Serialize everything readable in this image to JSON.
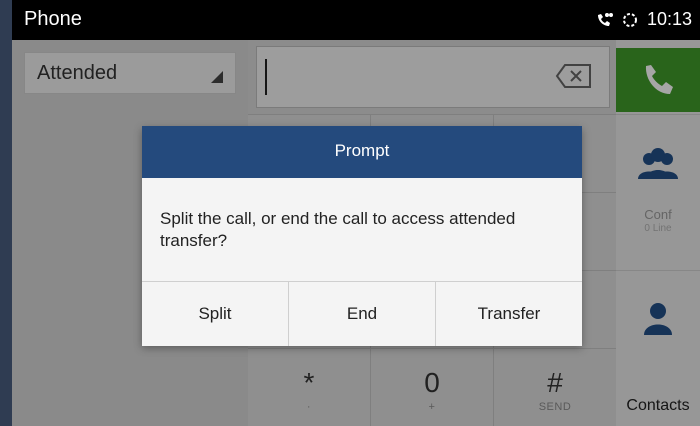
{
  "statusbar": {
    "title": "Phone",
    "time": "10:13",
    "icons": [
      "voicemail-icon",
      "sync-icon"
    ]
  },
  "left_panel": {
    "transfer_mode": "Attended"
  },
  "keypad": {
    "rows": [
      [
        {
          "main": "",
          "sub": ""
        },
        {
          "main": "",
          "sub": ""
        },
        {
          "main": "",
          "sub": ""
        }
      ],
      [
        {
          "main": "",
          "sub": ""
        },
        {
          "main": "",
          "sub": ""
        },
        {
          "main": "",
          "sub": ""
        }
      ],
      [
        {
          "main": "",
          "sub": ""
        },
        {
          "main": "",
          "sub": ""
        },
        {
          "main": "",
          "sub": ""
        }
      ],
      [
        {
          "main": "*",
          "sub": "·"
        },
        {
          "main": "0",
          "sub": "+"
        },
        {
          "main": "#",
          "sub": "SEND"
        }
      ]
    ]
  },
  "right_panel": {
    "conf_label": "Conf",
    "conf_sub": "0 Line",
    "contacts_label": "Contacts"
  },
  "dialog": {
    "title": "Prompt",
    "message": "Split the call, or end the call to access attended transfer?",
    "buttons": {
      "split": "Split",
      "end": "End",
      "transfer": "Transfer"
    }
  },
  "colors": {
    "dialog_header": "#244a7d",
    "call_button": "#3f9a2a",
    "accent_blue": "#1e4f86"
  }
}
